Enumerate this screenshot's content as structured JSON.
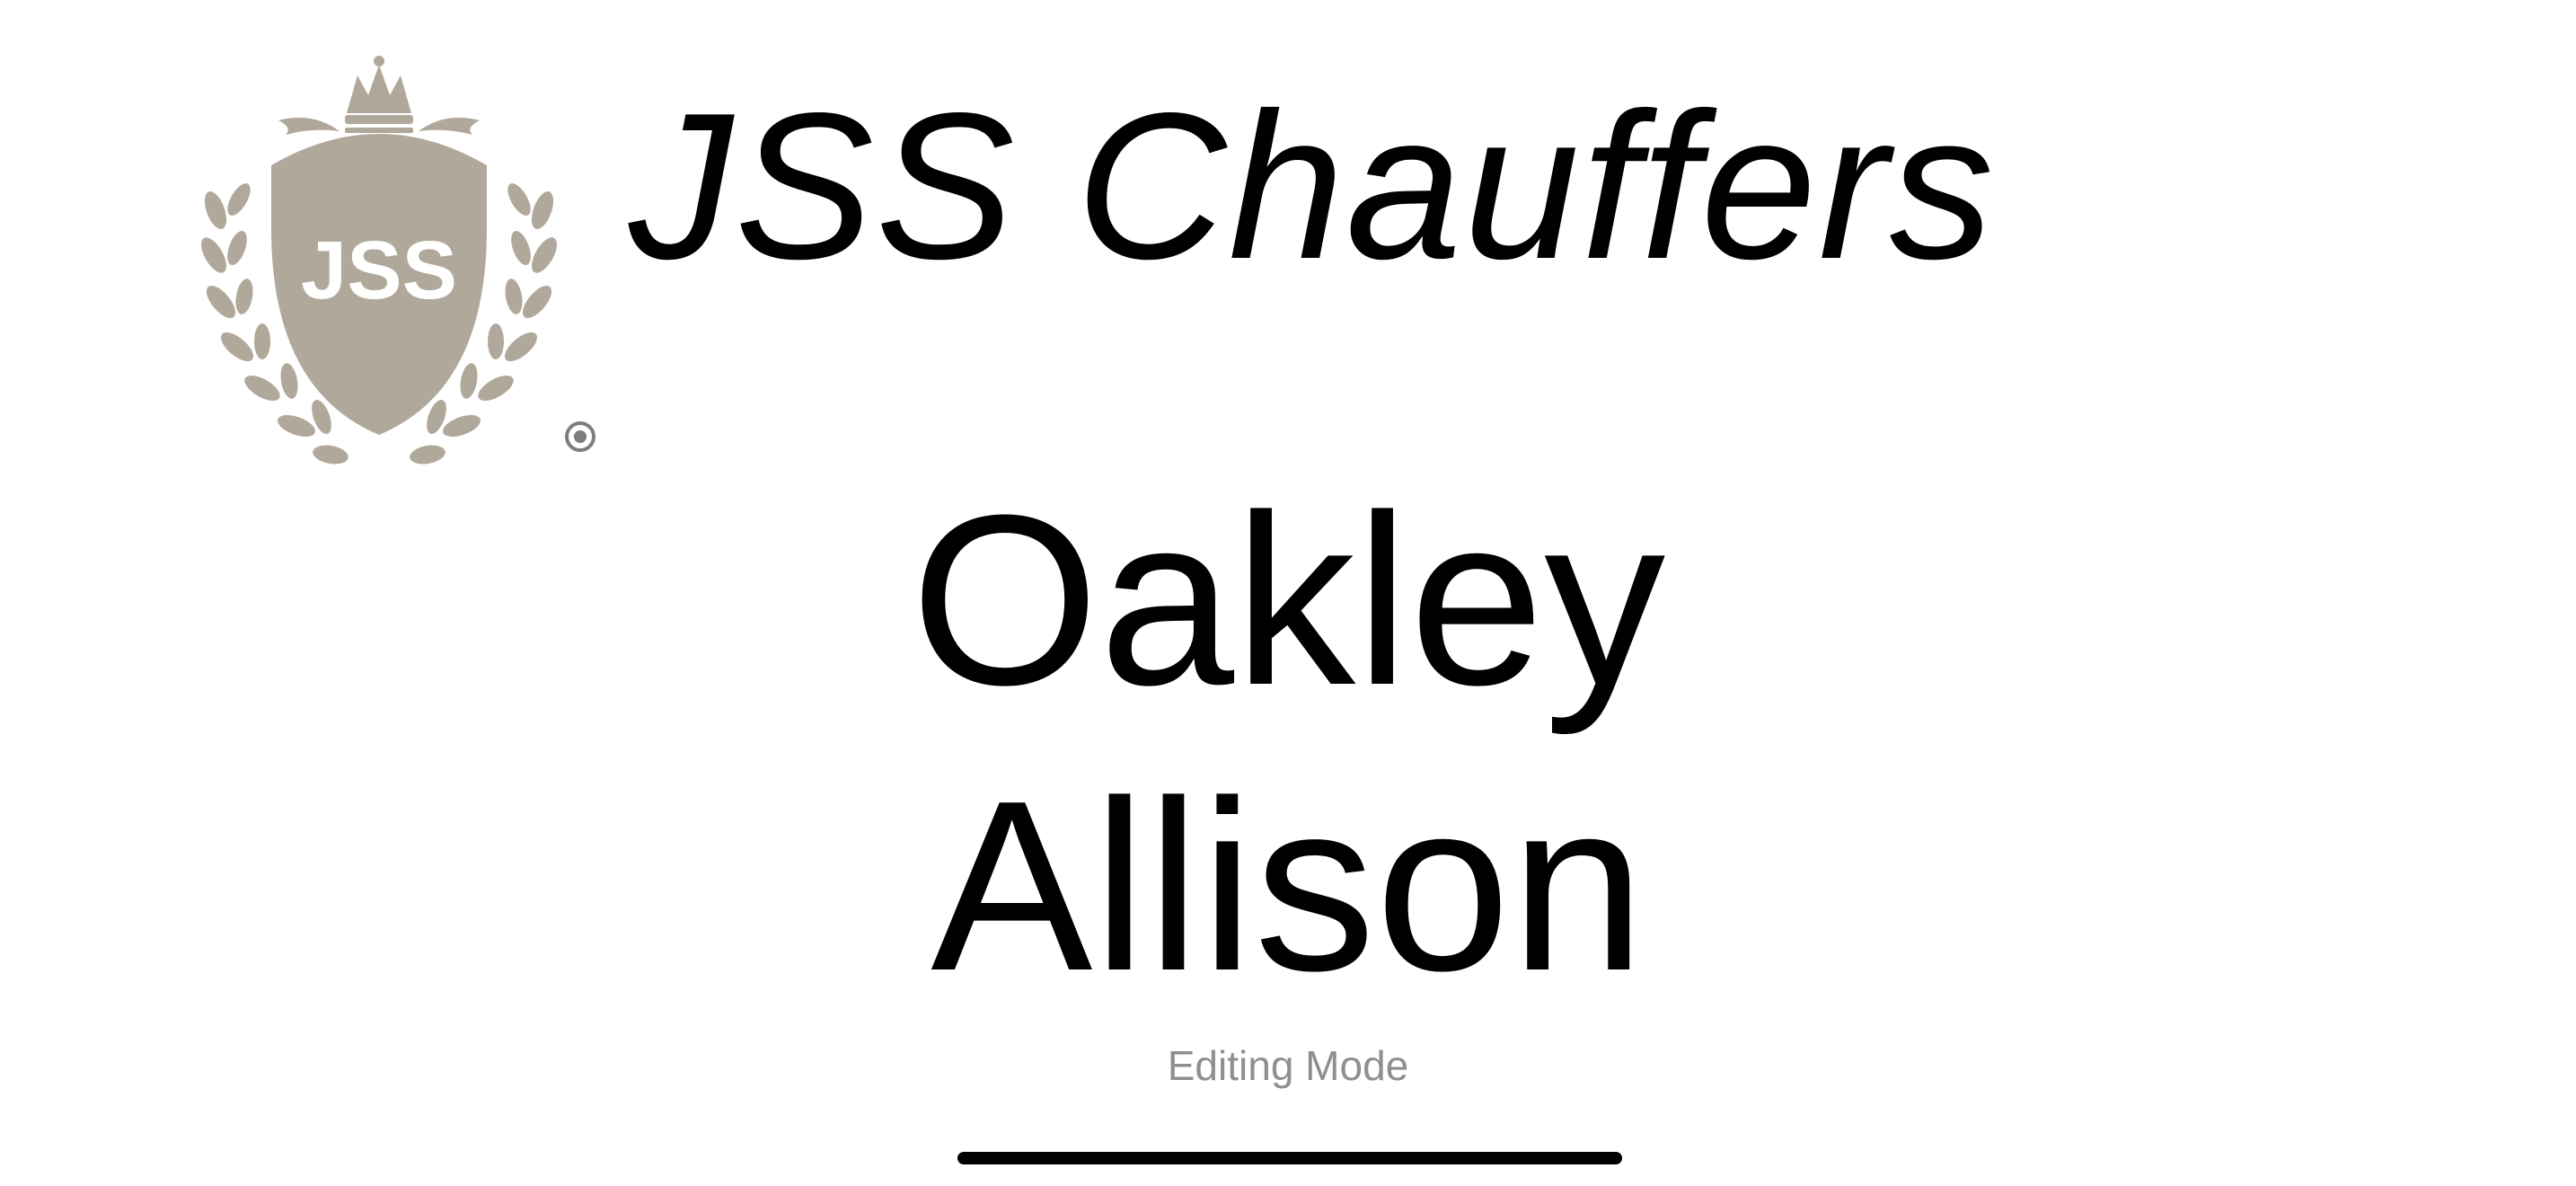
{
  "brand": {
    "title": "JSS Chauffers",
    "logo_monogram": "JSS",
    "logo_color": "#b0a89a"
  },
  "passenger": {
    "first_name": "Oakley",
    "last_name": "Allison"
  },
  "mode": {
    "label": "Editing Mode"
  },
  "icons": {
    "logo": "crest-laurel-logo",
    "registered_mark": "registered-mark-icon"
  },
  "colors": {
    "text": "#000000",
    "muted_text": "#8e8e93",
    "background": "#ffffff"
  }
}
